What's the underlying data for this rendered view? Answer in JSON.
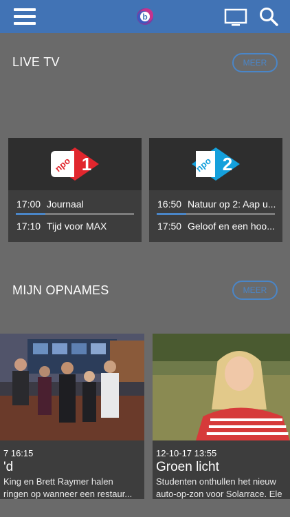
{
  "topbar": {
    "menu_icon": "hamburger-menu-icon",
    "logo_icon": "app-logo-icon",
    "cast_icon": "tv-icon",
    "search_icon": "search-icon"
  },
  "live_tv": {
    "title": "LIVE TV",
    "more_label": "MEER",
    "channels": [
      {
        "logo_text": "npo",
        "logo_number": "1",
        "logo_color": "#e1262d",
        "now_time": "17:00",
        "now_title": "Journaal",
        "progress": 0.25,
        "next_time": "17:10",
        "next_title": "Tijd voor MAX"
      },
      {
        "logo_text": "npo",
        "logo_number": "2",
        "logo_color": "#14a0dc",
        "now_time": "16:50",
        "now_title": "Natuur op 2: Aap u...",
        "progress": 0.25,
        "next_time": "17:50",
        "next_title": "Geloof en een hoo..."
      }
    ]
  },
  "recordings": {
    "title": "MIJN OPNAMES",
    "more_label": "MEER",
    "items": [
      {
        "date": "7 16:15",
        "title": "'d",
        "desc_line1": "King en Brett Raymer halen",
        "desc_line2": "ringen op wanneer een restaur..."
      },
      {
        "date": "12-10-17 13:55",
        "title": "Groen licht",
        "desc_line1": "Studenten onthullen het nieuw",
        "desc_line2": "auto-op-zon voor Solarrace. Ele"
      }
    ]
  },
  "colors": {
    "accent": "#4a86c8",
    "topbar": "#4173b5",
    "background": "#6a6a6a",
    "card": "#3d3d3d"
  }
}
